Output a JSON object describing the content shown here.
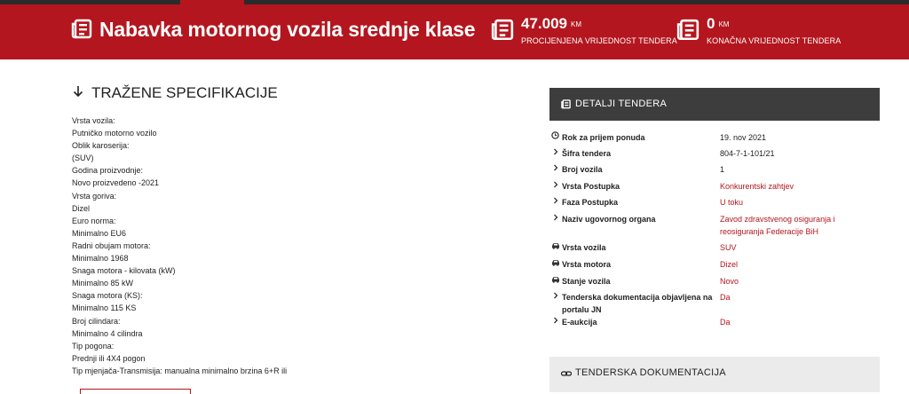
{
  "header": {
    "title": "Nabavka motornog vozila srednje klase",
    "stats": [
      {
        "value": "47.009",
        "unit": "KM",
        "label": "PROCIJENJENA VRIJEDNOST TENDERA"
      },
      {
        "value": "0",
        "unit": "KM",
        "label": "KONAČNA VRIJEDNOST TENDERA"
      }
    ]
  },
  "specs": {
    "heading": "TRAŽENE SPECIFIKACIJE",
    "lines": [
      "Vrsta vozila:",
      "Putničko motorno vozilo",
      "Oblik karoserija:",
      "(SUV)",
      "Godina proizvodnje:",
      "Novo proizvedeno -2021",
      "Vrsta goriva:",
      "Dizel",
      "Euro norma:",
      "Minimalno EU6",
      "Radni obujam motora:",
      "Minimalno 1968",
      "Snaga motora - kilovata (kW)",
      "Minimalno 85 kW",
      "Snaga motora (KS):",
      "Minimalno 115 KS",
      "Broj cilindara:",
      "Minimalno 4 cilindra",
      "Tip pogona:",
      "Prednji ili 4X4 pogon",
      "Tip mjenjača-Transmisija: manualna minimalno brzina 6+R ili"
    ]
  },
  "details": {
    "heading": "DETALJI TENDERA",
    "rows": [
      {
        "icon": "clock-icon",
        "label": "Rok za prijem ponuda",
        "value": "19. nov 2021",
        "highlight": false
      },
      {
        "icon": "chevron-right-icon",
        "label": "Šifra tendera",
        "value": "804-7-1-101/21",
        "highlight": false
      },
      {
        "icon": "chevron-right-icon",
        "label": "Broj vozila",
        "value": "1",
        "highlight": false
      },
      {
        "icon": "chevron-right-icon",
        "label": "Vrsta Postupka",
        "value": "Konkurentski zahtjev",
        "highlight": true
      },
      {
        "icon": "chevron-right-icon",
        "label": "Faza Postupka",
        "value": "U toku",
        "highlight": true
      },
      {
        "icon": "chevron-right-icon",
        "label": "Naziv ugovornog organa",
        "value": "Zavod zdravstvenog osiguranja i reosiguranja Federacije BiH",
        "highlight": true
      },
      {
        "icon": "car-icon",
        "label": "Vrsta vozila",
        "value": "SUV",
        "highlight": true
      },
      {
        "icon": "car-icon",
        "label": "Vrsta motora",
        "value": "Dizel",
        "highlight": true
      },
      {
        "icon": "car-icon",
        "label": "Stanje vozila",
        "value": "Novo",
        "highlight": true
      },
      {
        "icon": "chevron-right-icon",
        "label": "Tenderska dokumentacija objavljena na portalu JN",
        "value": "Da",
        "highlight": true
      },
      {
        "icon": "chevron-right-icon",
        "label": "E-aukcija",
        "value": "Da",
        "highlight": true
      }
    ]
  },
  "documentation": {
    "heading": "TENDERSKA DOKUMENTACIJA"
  },
  "colors": {
    "brand_red": "#b3161e",
    "dark_panel": "#3d3d3d",
    "light_panel": "#ebebeb"
  }
}
